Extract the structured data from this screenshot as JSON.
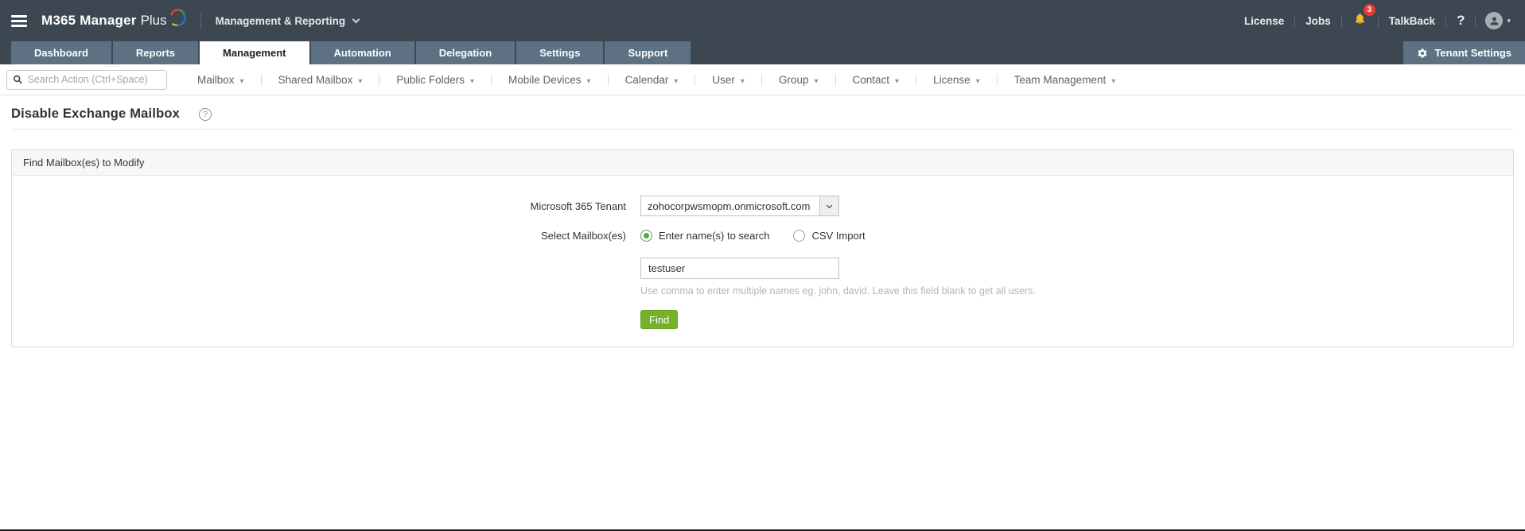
{
  "topbar": {
    "logo_bold": "M365 Manager",
    "logo_light": "Plus",
    "context_label": "Management & Reporting",
    "license": "License",
    "jobs": "Jobs",
    "notification_count": "3",
    "talkback": "TalkBack",
    "help_icon": "?"
  },
  "tabs": [
    {
      "label": "Dashboard"
    },
    {
      "label": "Reports"
    },
    {
      "label": "Management"
    },
    {
      "label": "Automation"
    },
    {
      "label": "Delegation"
    },
    {
      "label": "Settings"
    },
    {
      "label": "Support"
    }
  ],
  "tenant_settings_label": "Tenant Settings",
  "menubar": {
    "search_placeholder": "Search Action (Ctrl+Space)",
    "items": [
      "Mailbox",
      "Shared Mailbox",
      "Public Folders",
      "Mobile Devices",
      "Calendar",
      "User",
      "Group",
      "Contact",
      "License",
      "Team Management"
    ]
  },
  "page": {
    "title": "Disable Exchange Mailbox",
    "title_help_icon": "?"
  },
  "panel": {
    "header": "Find Mailbox(es) to Modify",
    "tenant_label": "Microsoft 365 Tenant",
    "tenant_value": "zohocorpwsmopm.onmicrosoft.com",
    "mailbox_label": "Select Mailbox(es)",
    "radio_search_label": "Enter name(s) to search",
    "radio_csv_label": "CSV Import",
    "name_value": "testuser",
    "hint": "Use comma to enter multiple names eg. john, david. Leave this field blank to get all users.",
    "find_label": "Find"
  },
  "colors": {
    "topbar_bg": "#3d4752",
    "tab_bg": "#5d7183",
    "active_tab_bg": "#ffffff",
    "accent_green": "#73b229",
    "badge_red": "#e23c33",
    "bell_yellow": "#f2b824"
  }
}
